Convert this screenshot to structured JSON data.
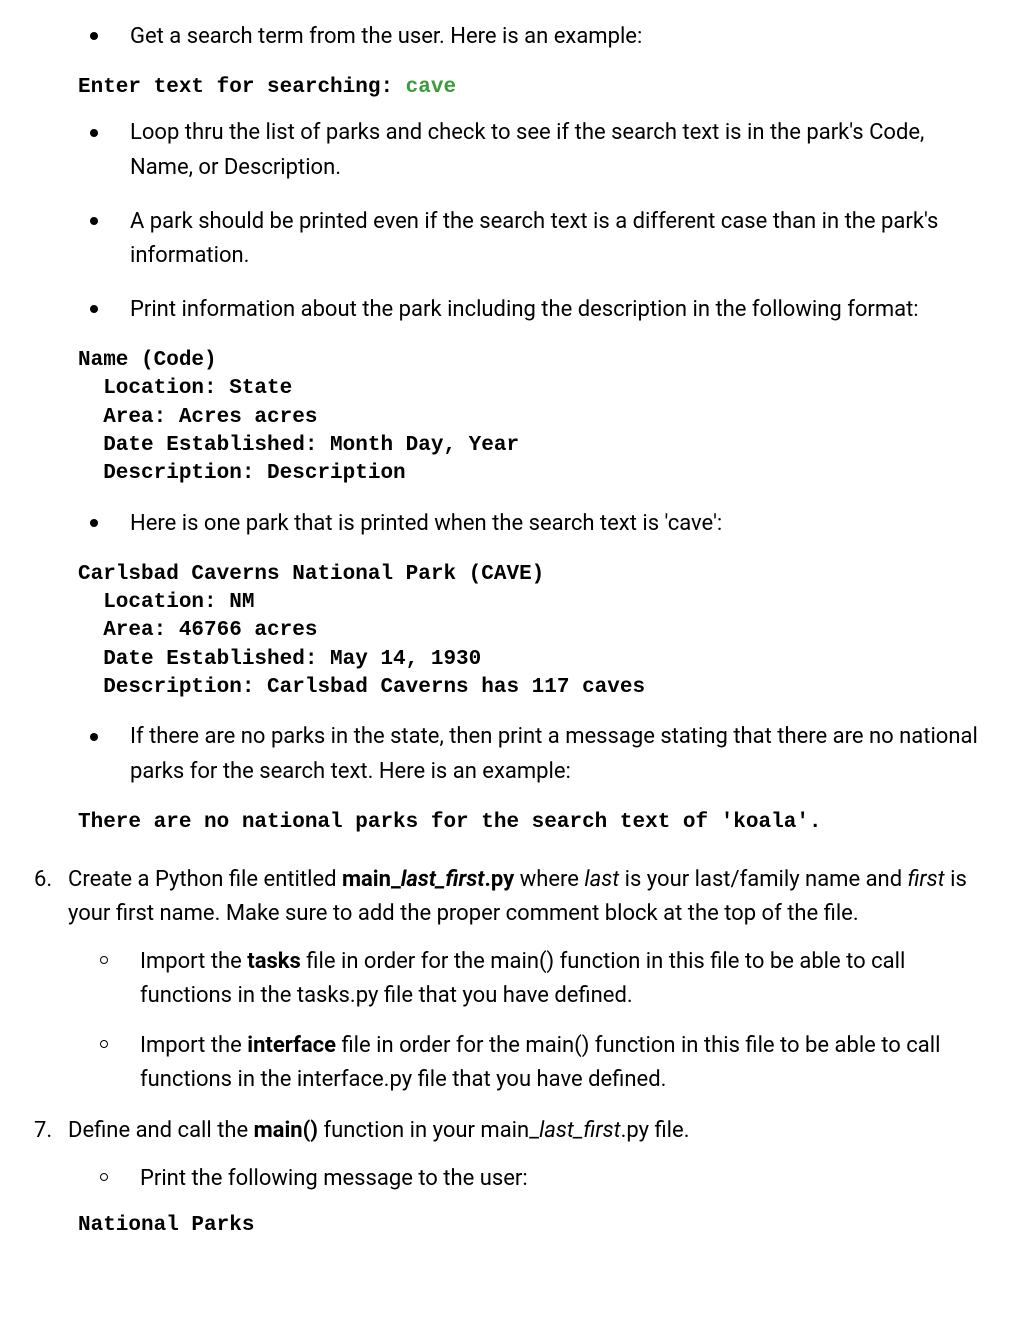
{
  "top": {
    "b0": "Get a search term from the user. Here is an example:"
  },
  "code1": {
    "prompt": "Enter text for searching: ",
    "input": "cave"
  },
  "mid_bullets": {
    "b1": "Loop thru the list of parks and check to see if the search text is in the park's Code, Name, or Description.",
    "b2": "A park should be printed even if the search text is a different case than in the park's information.",
    "b3": "Print information about the park including the description in the following format:"
  },
  "code2": "Name (Code)\n  Location: State\n  Area: Acres acres\n  Date Established: Month Day, Year\n  Description: Description",
  "mid_bullets2": {
    "b4": "Here is one park that is printed when the search text is 'cave':"
  },
  "code3": "Carlsbad Caverns National Park (CAVE)\n  Location: NM\n  Area: 46766 acres\n  Date Established: May 14, 1930\n  Description: Carlsbad Caverns has 117 caves",
  "mid_bullets3": {
    "b5": "If there are no parks in the state, then print a message stating that there are no national parks for the search text. Here is an example:"
  },
  "code4": "There are no national parks for the search text of 'koala'.",
  "step6": {
    "num": "6.",
    "t0": "Create a Python file entitled ",
    "t1": "main_",
    "t2": "last_first",
    "t3": ".py",
    "t4": " where ",
    "t5": "last",
    "t6": " is your last/family name and ",
    "t7": "first",
    "t8": " is your first name. Make sure to add the proper comment block at the top of the file.",
    "c1a": "Import the ",
    "c1b": "tasks",
    "c1c": " file in order for the main() function in this file to be able to call functions in the tasks.py file that you have defined.",
    "c2a": "Import the ",
    "c2b": "interface",
    "c2c": " file in order for the main() function in this file to be able to call functions in the interface.py file that you have defined."
  },
  "step7": {
    "num": "7.",
    "t0": "Define and call the ",
    "t1": "main()",
    "t2": " function in your main_",
    "t3": "last_first",
    "t4": ".py file.",
    "c1": "Print the following message to the user:"
  },
  "code5": "National Parks"
}
